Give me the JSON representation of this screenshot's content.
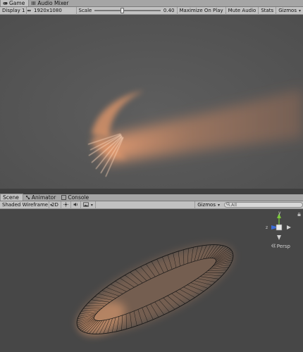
{
  "top_tabs": [
    {
      "label": "Game",
      "icon": "game-controller-icon",
      "active": true
    },
    {
      "label": "Audio Mixer",
      "icon": "audio-mixer-icon",
      "active": false
    }
  ],
  "game_toolbar": {
    "display": "Display 1",
    "resolution": "1920x1080",
    "scale_label": "Scale",
    "scale_value": "0.40",
    "scale_fraction": 0.37,
    "maximize_on_play": "Maximize On Play",
    "mute_audio": "Mute Audio",
    "stats": "Stats",
    "gizmos": "Gizmos"
  },
  "bottom_tabs": [
    {
      "label": "Scene",
      "icon": "",
      "active": true
    },
    {
      "label": "Animator",
      "icon": "animator-icon",
      "active": false
    },
    {
      "label": "Console",
      "icon": "console-icon",
      "active": false
    }
  ],
  "scene_toolbar": {
    "shading_mode": "Shaded Wireframe",
    "mode_2d": "2D",
    "gizmos": "Gizmos",
    "search_placeholder": "All"
  },
  "scene_overlay": {
    "axes": {
      "y": "y",
      "z": "z"
    },
    "projection": "Persp"
  },
  "colors": {
    "particle_glow": "#e79a6a",
    "axis_x": "#d8403a",
    "axis_y": "#7ccc3a",
    "axis_z": "#3a6cd8",
    "game_background": "#585858",
    "scene_background": "#474747"
  }
}
